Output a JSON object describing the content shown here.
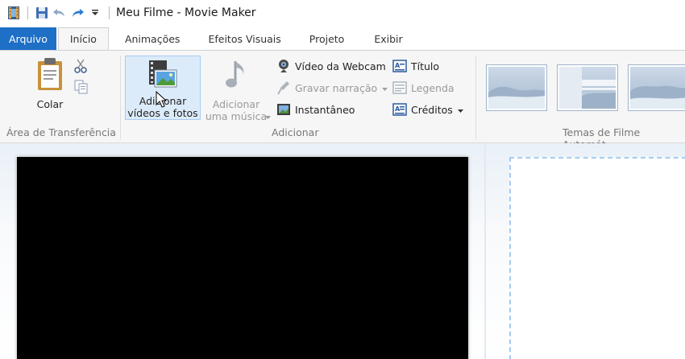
{
  "window": {
    "title": "Meu Filme - Movie Maker"
  },
  "tabs": [
    {
      "label": "Arquivo"
    },
    {
      "label": "Início"
    },
    {
      "label": "Animações"
    },
    {
      "label": "Efeitos Visuais"
    },
    {
      "label": "Projeto"
    },
    {
      "label": "Exibir"
    }
  ],
  "clipboard": {
    "group_label": "Área de Transferência",
    "paste_label": "Colar"
  },
  "add": {
    "group_label": "Adicionar",
    "add_videos_line1": "Adicionar",
    "add_videos_line2": "vídeos e fotos",
    "add_music_line1": "Adicionar",
    "add_music_line2": "uma música",
    "webcam_label": "Vídeo da Webcam",
    "narration_label": "Gravar narração",
    "snapshot_label": "Instantâneo",
    "title_label": "Título",
    "caption_label": "Legenda",
    "credits_label": "Créditos"
  },
  "themes": {
    "group_label": "Temas de Filme Automát"
  },
  "colors": {
    "file_tab": "#1e6fc6",
    "storyboard_border": "#a7cbee",
    "preview_bg": "#000000"
  }
}
